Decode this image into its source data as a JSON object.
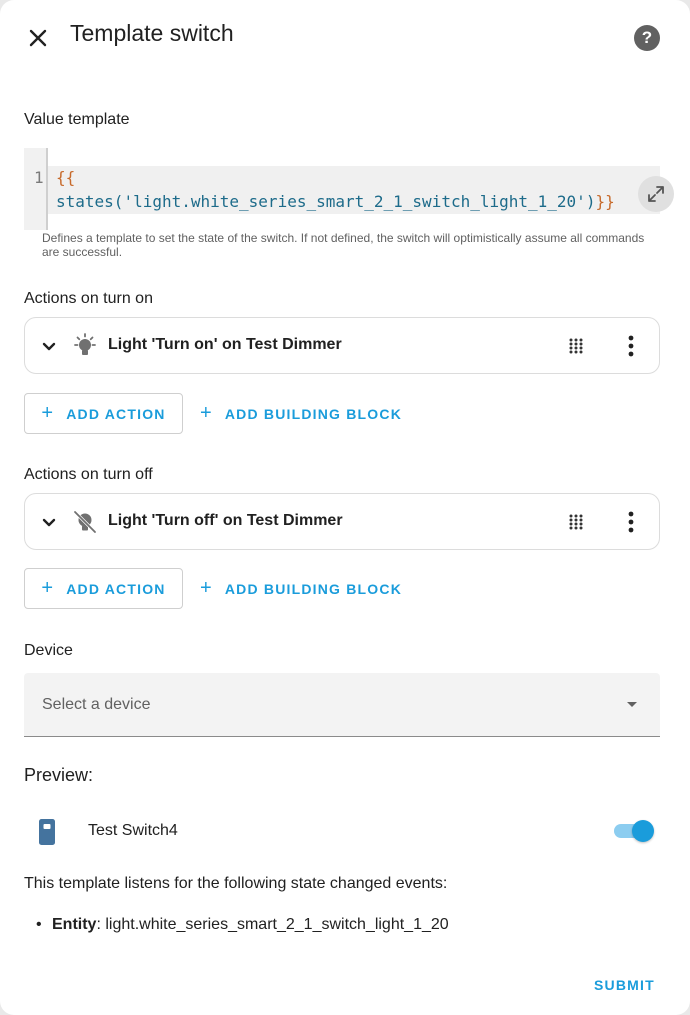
{
  "dialog": {
    "title": "Template switch",
    "close_icon": "close-icon",
    "help_icon": "help-icon"
  },
  "value_template": {
    "label": "Value template",
    "line_number": "1",
    "code_line1": "{{",
    "code_fn": "states",
    "code_open": "(",
    "code_string": "'light.white_series_smart_2_1_switch_light_1_20'",
    "code_close": ")",
    "code_end": "}}",
    "helper": "Defines a template to set the state of the switch. If not defined, the switch will optimistically assume all commands are successful."
  },
  "turn_on": {
    "label": "Actions on turn on",
    "action_label": "Light 'Turn on' on Test Dimmer",
    "add_action": "ADD ACTION",
    "add_block": "ADD BUILDING BLOCK"
  },
  "turn_off": {
    "label": "Actions on turn off",
    "action_label": "Light 'Turn off' on Test Dimmer",
    "add_action": "ADD ACTION",
    "add_block": "ADD BUILDING BLOCK"
  },
  "device": {
    "label": "Device",
    "placeholder": "Select a device"
  },
  "preview": {
    "title": "Preview:",
    "entity_name": "Test Switch4",
    "toggle_on": true,
    "listen_text": "This template listens for the following state changed events:",
    "entity_key": "Entity",
    "entity_value": ": light.white_series_smart_2_1_switch_light_1_20"
  },
  "footer": {
    "submit": "SUBMIT"
  },
  "colors": {
    "accent": "#1a9cdb",
    "icon_blue": "#44739e"
  }
}
